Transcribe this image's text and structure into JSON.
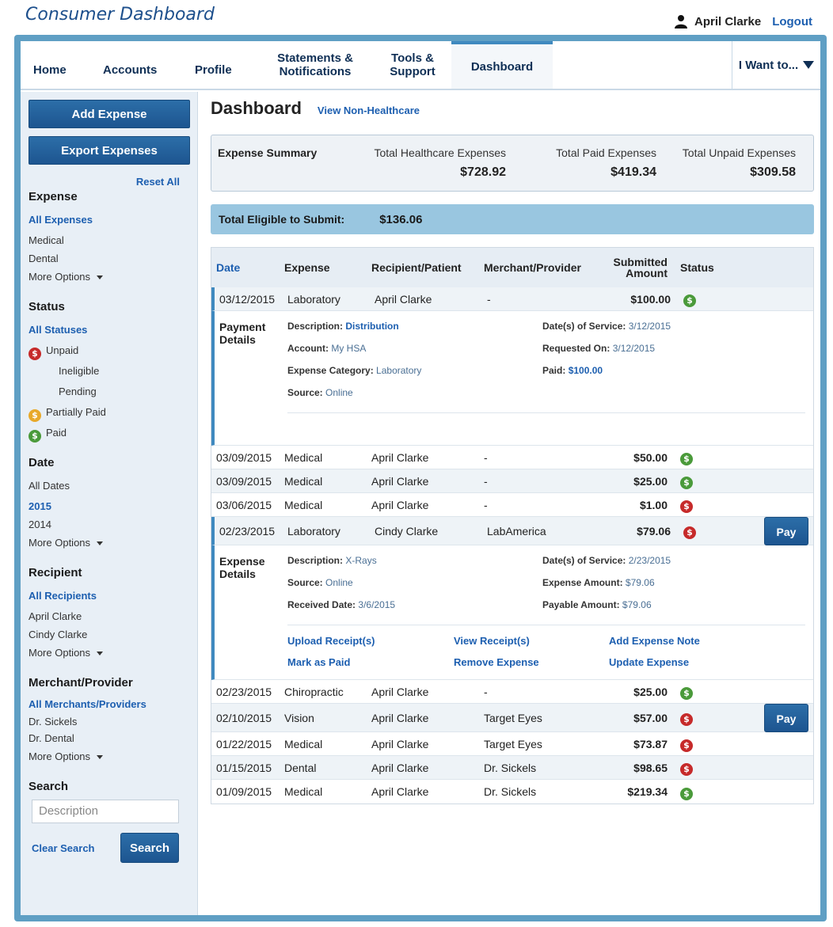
{
  "page": {
    "title": "Consumer Dashboard"
  },
  "user": {
    "name": "April Clarke",
    "logout": "Logout"
  },
  "nav": {
    "home": "Home",
    "accounts": "Accounts",
    "profile": "Profile",
    "statements_1": "Statements &",
    "statements_2": "Notifications",
    "tools_1": "Tools &",
    "tools_2": "Support",
    "dashboard": "Dashboard",
    "i_want": "I Want to..."
  },
  "sidebar": {
    "add_expense": "Add Expense",
    "export_expenses": "Export Expenses",
    "reset_all": "Reset All",
    "expense": {
      "heading": "Expense",
      "items": [
        "All Expenses",
        "Medical",
        "Dental"
      ],
      "more": "More Options"
    },
    "status": {
      "heading": "Status",
      "all": "All Statuses",
      "unpaid": "Unpaid",
      "ineligible": "Ineligible",
      "pending": "Pending",
      "partially_paid": "Partially Paid",
      "paid": "Paid"
    },
    "date": {
      "heading": "Date",
      "items": [
        "All Dates",
        "2015",
        "2014"
      ],
      "more": "More Options"
    },
    "recipient": {
      "heading": "Recipient",
      "items": [
        "All Recipients",
        "April Clarke",
        "Cindy Clarke"
      ],
      "more": "More Options"
    },
    "merchant": {
      "heading": "Merchant/Provider",
      "items": [
        "All Merchants/Providers",
        "Dr. Sickels",
        "Dr. Dental"
      ],
      "more": "More Options"
    },
    "search": {
      "heading": "Search",
      "placeholder": "Description",
      "clear": "Clear Search",
      "button": "Search"
    }
  },
  "main": {
    "title": "Dashboard",
    "view_non_healthcare": "View Non-Healthcare",
    "summary": {
      "label": "Expense Summary",
      "total_hc_label": "Total Healthcare Expenses",
      "total_hc": "$728.92",
      "paid_label": "Total Paid Expenses",
      "paid": "$419.34",
      "unpaid_label": "Total Unpaid Expenses",
      "unpaid": "$309.58"
    },
    "eligible": {
      "label": "Total Eligible to Submit:",
      "amount": "$136.06"
    },
    "columns": {
      "date": "Date",
      "expense": "Expense",
      "recipient": "Recipient/Patient",
      "merchant": "Merchant/Provider",
      "submitted_1": "Submitted",
      "submitted_2": "Amount",
      "status": "Status"
    },
    "rows": [
      {
        "date": "03/12/2015",
        "expense": "Laboratory",
        "recipient": "April Clarke",
        "merchant": "-",
        "amount": "$100.00",
        "status": "paid"
      },
      {
        "date": "03/09/2015",
        "expense": "Medical",
        "recipient": "April Clarke",
        "merchant": "-",
        "amount": "$50.00",
        "status": "paid"
      },
      {
        "date": "03/09/2015",
        "expense": "Medical",
        "recipient": "April Clarke",
        "merchant": "-",
        "amount": "$25.00",
        "status": "paid"
      },
      {
        "date": "03/06/2015",
        "expense": "Medical",
        "recipient": "April Clarke",
        "merchant": "-",
        "amount": "$1.00",
        "status": "unpaid"
      },
      {
        "date": "02/23/2015",
        "expense": "Laboratory",
        "recipient": "Cindy Clarke",
        "merchant": "LabAmerica",
        "amount": "$79.06",
        "status": "unpaid",
        "pay": "Pay"
      },
      {
        "date": "02/23/2015",
        "expense": "Chiropractic",
        "recipient": "April Clarke",
        "merchant": "-",
        "amount": "$25.00",
        "status": "paid"
      },
      {
        "date": "02/10/2015",
        "expense": "Vision",
        "recipient": "April Clarke",
        "merchant": "Target Eyes",
        "amount": "$57.00",
        "status": "unpaid",
        "pay": "Pay"
      },
      {
        "date": "01/22/2015",
        "expense": "Medical",
        "recipient": "April Clarke",
        "merchant": "Target Eyes",
        "amount": "$73.87",
        "status": "unpaid"
      },
      {
        "date": "01/15/2015",
        "expense": "Dental",
        "recipient": "April Clarke",
        "merchant": "Dr. Sickels",
        "amount": "$98.65",
        "status": "unpaid"
      },
      {
        "date": "01/09/2015",
        "expense": "Medical",
        "recipient": "April Clarke",
        "merchant": "Dr. Sickels",
        "amount": "$219.34",
        "status": "paid"
      }
    ],
    "payment_details": {
      "title_1": "Payment",
      "title_2": "Details",
      "description_label": "Description:",
      "description": "Distribution",
      "account_label": "Account:",
      "account": "My HSA",
      "category_label": "Expense Category:",
      "category": "Laboratory",
      "source_label": "Source:",
      "source": "Online",
      "service_label": "Date(s) of Service:",
      "service": "3/12/2015",
      "requested_label": "Requested On:",
      "requested": "3/12/2015",
      "paid_label": "Paid:",
      "paid": "$100.00"
    },
    "expense_details": {
      "title_1": "Expense",
      "title_2": "Details",
      "description_label": "Description:",
      "description": "X-Rays",
      "source_label": "Source:",
      "source": "Online",
      "received_label": "Received Date:",
      "received": "3/6/2015",
      "service_label": "Date(s) of Service:",
      "service": "2/23/2015",
      "expense_amount_label": "Expense Amount:",
      "expense_amount": "$79.06",
      "payable_label": "Payable Amount:",
      "payable": "$79.06",
      "upload": "Upload Receipt(s)",
      "view": "View Receipt(s)",
      "add_note": "Add Expense Note",
      "mark_paid": "Mark as Paid",
      "remove": "Remove Expense",
      "update": "Update Expense"
    }
  },
  "colors": {
    "accent": "#1d5fb0",
    "frame": "#5f9fc4",
    "paid": "#4a9a3a",
    "unpaid": "#c62a2a",
    "partial": "#e8a92a"
  }
}
